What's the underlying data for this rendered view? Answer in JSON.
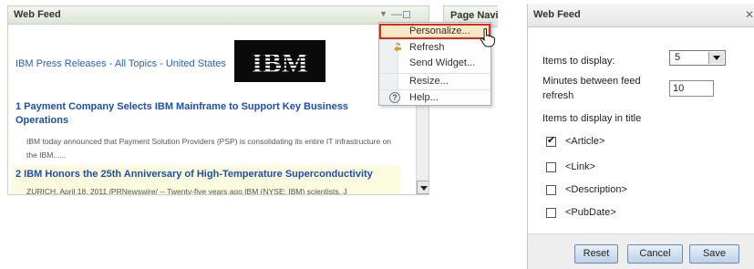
{
  "feed_widget": {
    "title": "Web Feed",
    "source_link": "IBM Press Releases - All Topics - United States",
    "logo_text": "IBM",
    "articles": [
      {
        "title": "1 Payment Company Selects IBM Mainframe to Support Key Business Operations",
        "summary": "IBM today announced that Payment Solution Providers (PSP) is consolidating its entire IT infrastructure on the IBM......"
      },
      {
        "title": "2 IBM Honors the 25th Anniversary of High-Temperature Superconductivity",
        "summary": "ZURICH, April 18, 2011 /PRNewswire/ -- Twenty-five years ago IBM (NYSE: IBM) scientists, J"
      }
    ]
  },
  "page_navigator": {
    "label": "Page Navi"
  },
  "widget_menu": {
    "items": [
      {
        "label": "Personalize...",
        "highlighted": true
      },
      {
        "label": "Refresh",
        "icon": "refresh-icon"
      },
      {
        "label": "Send Widget..."
      },
      {
        "label": "Resize..."
      },
      {
        "label": "Help...",
        "icon": "help-icon"
      }
    ]
  },
  "personalize_dialog": {
    "title": "Web Feed",
    "items_to_display_label": "Items to display:",
    "items_to_display_value": "5",
    "minutes_label": "Minutes between feed refresh",
    "minutes_value": "10",
    "title_items_label": "Items to display in title",
    "title_options": [
      {
        "label": "<Article>",
        "checked": true
      },
      {
        "label": "<Link>",
        "checked": false
      },
      {
        "label": "<Description>",
        "checked": false
      },
      {
        "label": "<PubDate>",
        "checked": false
      }
    ],
    "buttons": {
      "reset": "Reset",
      "cancel": "Cancel",
      "save": "Save"
    }
  },
  "colors": {
    "link_blue": "#1f4fa5",
    "menu_highlight": "#f7e9c6",
    "highlight_border": "#e0261f",
    "button_border": "#6f8cb0"
  }
}
